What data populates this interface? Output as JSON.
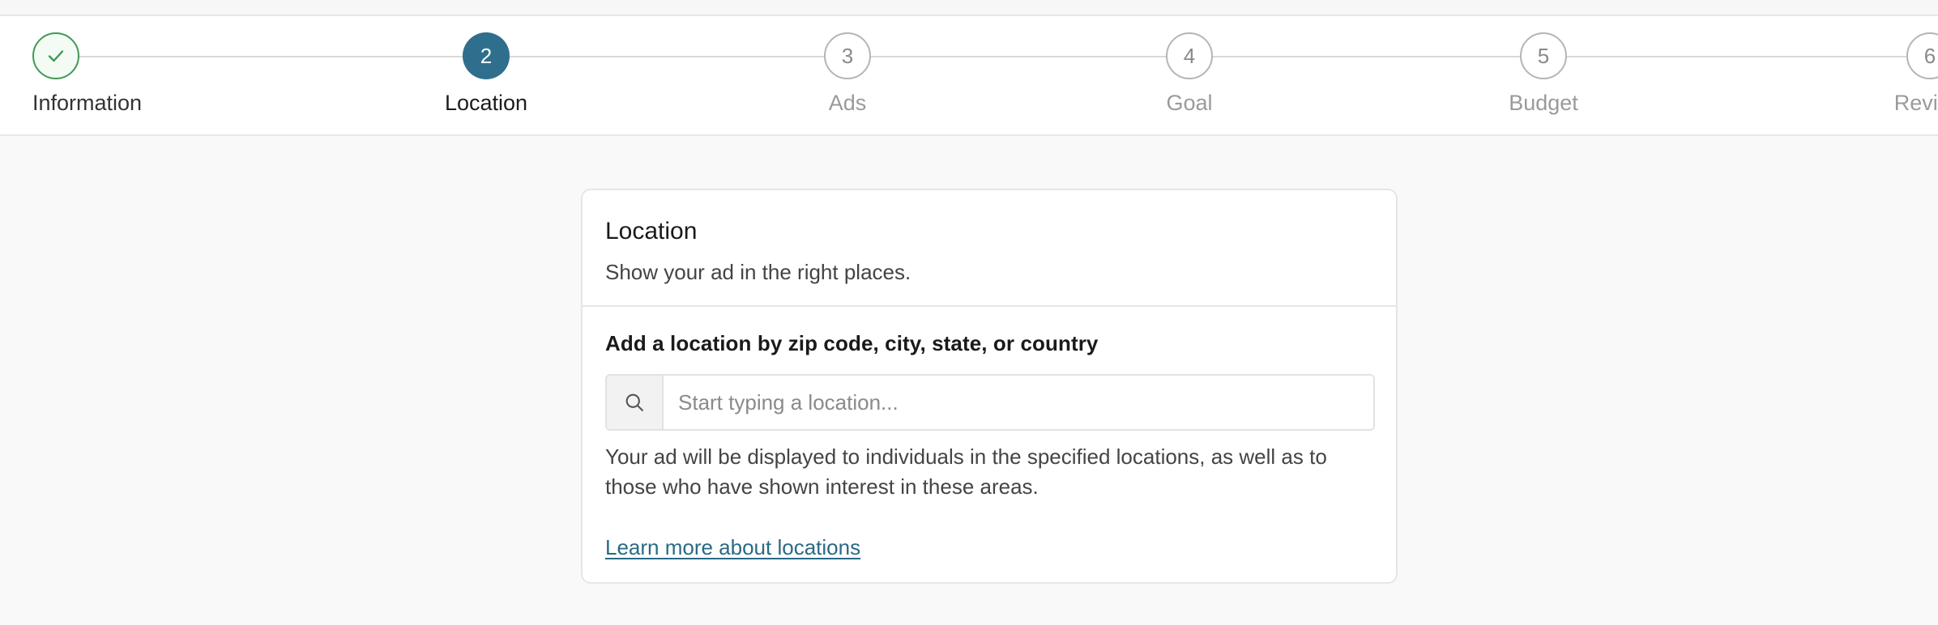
{
  "stepper": {
    "steps": [
      {
        "number": "",
        "label": "Information",
        "state": "done",
        "icon": "check-icon"
      },
      {
        "number": "2",
        "label": "Location",
        "state": "active"
      },
      {
        "number": "3",
        "label": "Ads",
        "state": "pending"
      },
      {
        "number": "4",
        "label": "Goal",
        "state": "pending"
      },
      {
        "number": "5",
        "label": "Budget",
        "state": "pending"
      },
      {
        "number": "6",
        "label": "Review",
        "state": "pending"
      }
    ]
  },
  "card": {
    "title": "Location",
    "subtitle": "Show your ad in the right places.",
    "field_label": "Add a location by zip code, city, state, or country",
    "search_placeholder": "Start typing a location...",
    "search_value": "",
    "help_text": "Your ad will be displayed to individuals in the specified locations, as well as to those who have shown interest in these areas.",
    "link_text": "Learn more about locations"
  },
  "colors": {
    "accent": "#2f6f8d",
    "done": "#3f9a54",
    "link": "#2a6a86"
  }
}
